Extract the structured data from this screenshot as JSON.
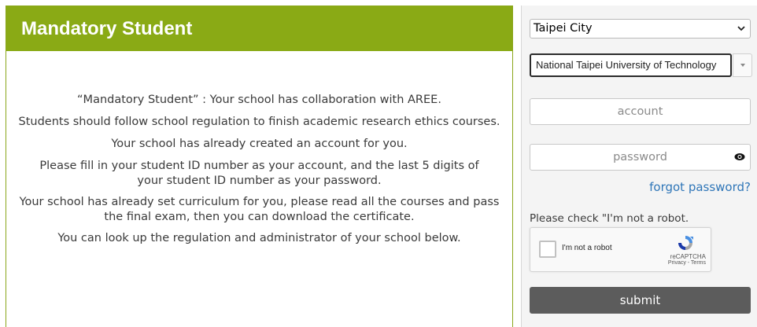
{
  "header": {
    "title": "Mandatory Student"
  },
  "info": {
    "paragraphs": [
      "“Mandatory Student” : Your school has collaboration with AREE.",
      "Students should follow school regulation to finish academic research ethics courses.",
      "Your school has already created an account for you.",
      "Please fill in your student ID number as your account, and the last 5 digits of your student ID number as your password.",
      "Your school has already set curriculum for you, please read all the courses and pass the final exam, then you can download the certificate.",
      "You can look up the regulation and administrator of your school below."
    ]
  },
  "login": {
    "city_select": {
      "value": "Taipei City",
      "icon": "chevron-down-icon"
    },
    "school_select": {
      "value": "National Taipei University of Technology",
      "icon": "caret-down-icon"
    },
    "account": {
      "placeholder": "account"
    },
    "password": {
      "placeholder": "password",
      "icon": "eye-icon"
    },
    "forgot_password": "forgot password?",
    "robot_note": "Please check \"I'm not a robot.",
    "recaptcha": {
      "label": "I'm not a robot",
      "brand": "reCAPTCHA",
      "terms": "Privacy - Terms",
      "icon": "recaptcha-logo-icon"
    },
    "submit_label": "submit"
  },
  "colors": {
    "header_bg": "#8aaa15",
    "submit_bg": "#5c5c5c",
    "link": "#2f76b8",
    "side_bg": "#f4f4f4"
  }
}
